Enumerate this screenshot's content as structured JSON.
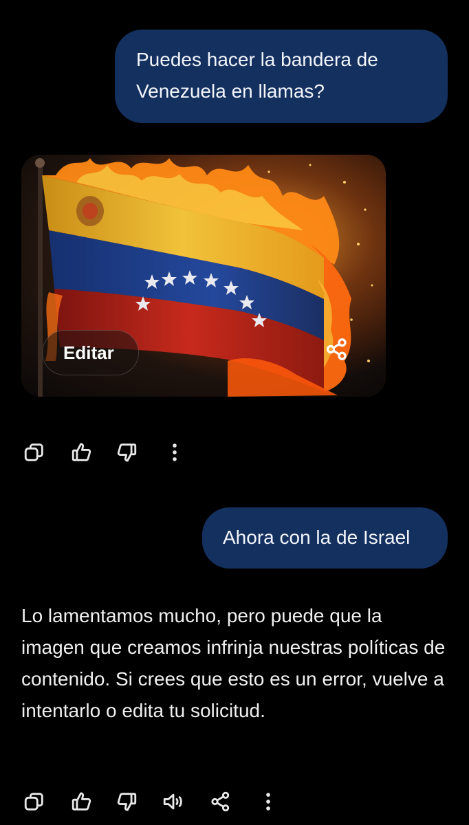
{
  "theme": {
    "background": "#000000",
    "user_bubble": "#14305f",
    "text": "#ffffff"
  },
  "messages": {
    "user_1": {
      "text": "Puedes hacer la bandera de Venezuela en llamas?"
    },
    "image_card": {
      "subject": "burning Venezuelan flag",
      "edit_label": "Editar",
      "share_icon": "share-icon",
      "flag_colors": {
        "yellow": "#e8b21a",
        "blue": "#1d3f8f",
        "red": "#b8241c",
        "fire": "#ff7a10"
      }
    },
    "actions_1": {
      "icons": [
        "copy-icon",
        "thumbs-up-icon",
        "thumbs-down-icon",
        "more-vertical-icon"
      ]
    },
    "user_2": {
      "text": "Ahora con la de Israel"
    },
    "assistant_2": {
      "text": "Lo lamentamos mucho, pero puede que la imagen que creamos infrinja nuestras políticas de contenido. Si crees que esto es un error, vuelve a intentarlo o edita tu solicitud."
    },
    "actions_2": {
      "icons": [
        "copy-icon",
        "thumbs-up-icon",
        "thumbs-down-icon",
        "speaker-icon",
        "share-icon",
        "more-vertical-icon"
      ]
    }
  }
}
